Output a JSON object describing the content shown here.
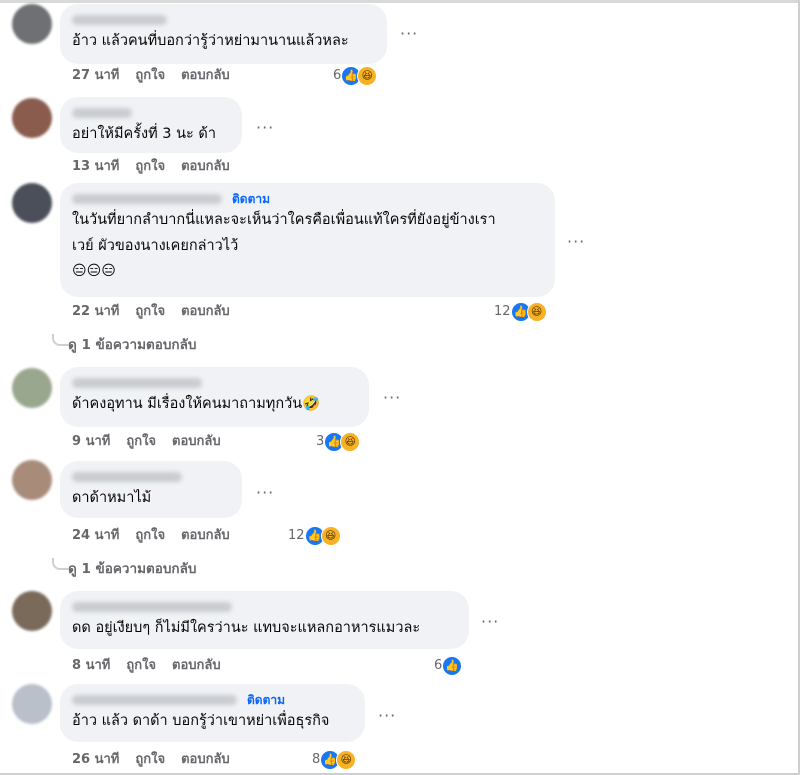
{
  "labels": {
    "like": "ถูกใจ",
    "reply": "ตอบกลับ",
    "follow": "ติดตาม",
    "more": "···"
  },
  "colors": {
    "bubble": "#f0f2f5",
    "muted": "#65676b",
    "link": "#0866ff",
    "like": "#1877f2",
    "haha": "#f7b125"
  },
  "comments": [
    {
      "text": "อ้าว แล้วคนที่บอกว่ารู้ว่าหย่ามานานแล้วหละ",
      "time": "27 นาที",
      "reaction_count": "6",
      "reactions": [
        "like-icon",
        "haha-icon"
      ]
    },
    {
      "text": "อย่าให้มีครั้งที่ 3 นะ ด้า",
      "time": "13 นาที"
    },
    {
      "text": "ในวันที่ยากลำบากนี่แหละจะเห็นว่าใครคือเพื่อนแท้ใครที่ยังอยู่ข้างเรา",
      "text2": "เวย์ ผัวของนางเคยกล่าวไว้",
      "emojis": "😑😑😑",
      "time": "22 นาที",
      "reaction_count": "12",
      "reactions": [
        "like-icon",
        "haha-icon"
      ],
      "replies": "ดู 1 ข้อความตอบกลับ"
    },
    {
      "text": "ด้าคงอุทาน มีเรื่องให้คนมาถามทุกวัน🤣",
      "time": "9 นาที",
      "reaction_count": "3",
      "reactions": [
        "like-icon",
        "haha-icon"
      ]
    },
    {
      "text": "ดาด้าหมาไม้",
      "time": "24 นาที",
      "reaction_count": "12",
      "reactions": [
        "like-icon",
        "haha-icon"
      ],
      "replies": "ดู 1 ข้อความตอบกลับ"
    },
    {
      "text": "ดด อยู่เงียบๆ ก็ไม่มีใครว่านะ แทบจะแหลกอาหารแมวละ",
      "time": "8 นาที",
      "reaction_count": "6",
      "reactions": [
        "like-icon"
      ]
    },
    {
      "text": "อ้าว แล้ว ดาด้า บอกรู้ว่าเขาหย่าเพื่อธุรกิจ",
      "time": "26 นาที",
      "reaction_count": "8",
      "reactions": [
        "like-icon",
        "haha-icon"
      ]
    }
  ]
}
